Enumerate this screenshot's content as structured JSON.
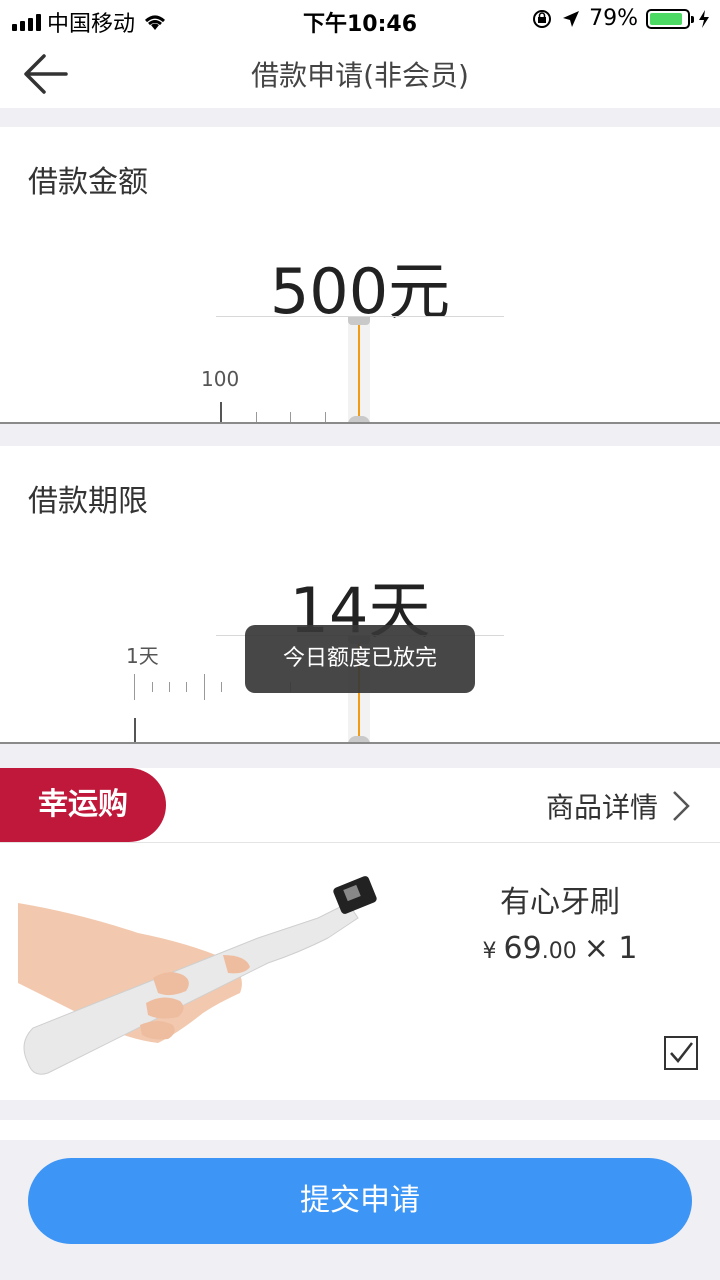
{
  "status_bar": {
    "carrier": "中国移动",
    "time": "下午10:46",
    "battery_percent_text": "79%",
    "battery_level": 0.79
  },
  "nav": {
    "title": "借款申请(非会员)",
    "back_icon": "arrow-left-icon"
  },
  "amount": {
    "label": "借款金额",
    "value": "500元",
    "tick_label": "100"
  },
  "term": {
    "label": "借款期限",
    "value": "14天",
    "tick_label": "1天"
  },
  "toast": {
    "text": "今日额度已放完"
  },
  "lucky": {
    "badge": "幸运购",
    "detail_link": "商品详情",
    "product": {
      "name": "有心牙刷",
      "currency": "¥",
      "price_main": "69",
      "price_decimal": ".00",
      "quantity": "× 1",
      "checked": true
    }
  },
  "submit": {
    "label": "提交申请"
  },
  "colors": {
    "accent_blue": "#3d95f5",
    "badge_red": "#c0183a",
    "pointer_orange": "#f39c12"
  }
}
